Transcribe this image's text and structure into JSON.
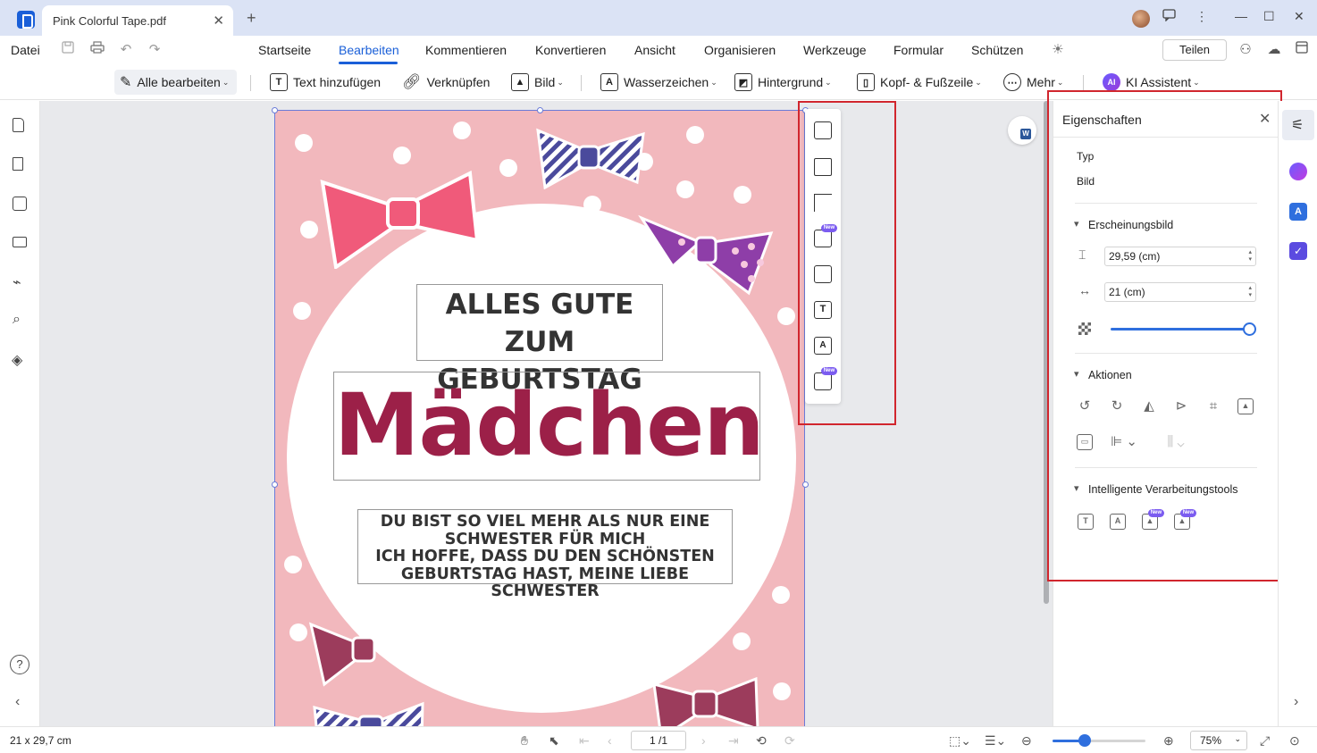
{
  "window": {
    "tab_title": "Pink Colorful Tape.pdf",
    "tab_close": "✕",
    "new_tab": "+",
    "min": "—",
    "max": "☐",
    "close": "✕"
  },
  "menubar": {
    "file": "Datei",
    "tabs": [
      "Startseite",
      "Bearbeiten",
      "Kommentieren",
      "Konvertieren",
      "Ansicht",
      "Organisieren",
      "Werkzeuge",
      "Formular",
      "Schützen"
    ],
    "active_tab": "Bearbeiten",
    "share": "Teilen"
  },
  "toolbar": {
    "edit_all": "Alle bearbeiten",
    "add_text": "Text hinzufügen",
    "link": "Verknüpfen",
    "image": "Bild",
    "watermark": "Wasserzeichen",
    "background": "Hintergrund",
    "header_footer": "Kopf- & Fußzeile",
    "more": "Mehr",
    "ai_badge": "AI",
    "ai_assistant": "KI Assistent"
  },
  "document": {
    "headline_line1": "ALLES GUTE ZUM",
    "headline_line2": "GEBURTSTAG",
    "name": "Mädchen",
    "message_line1": "DU BIST SO VIEL MEHR ALS NUR EINE",
    "message_line2": "SCHWESTER FÜR MICH",
    "message_line3": "ICH HOFFE, DASS DU DEN SCHÖNSTEN",
    "message_line4": "GEBURTSTAG HAST, MEINE LIEBE SCHWESTER",
    "colors": {
      "page_bg": "#f2b8bd",
      "name_color": "#9c2048"
    }
  },
  "float_toolbar": {
    "new_badge": "New",
    "icons": [
      "add-image-icon",
      "save-image-icon",
      "crop-icon",
      "ai-image-icon",
      "replace-image-icon",
      "ocr-text-icon",
      "translate-image-icon",
      "ai-enhance-icon"
    ]
  },
  "panel": {
    "title": "Eigenschaften",
    "close": "✕",
    "type_label": "Typ",
    "type_value": "Bild",
    "appearance": "Erscheinungsbild",
    "height_value": "29,59 (cm)",
    "width_value": "21 (cm)",
    "opacity": 1.0,
    "actions": "Aktionen",
    "smart_tools": "Intelligente Verarbeitungstools",
    "new_badge": "New"
  },
  "statusbar": {
    "page_size": "21 x 29,7 cm",
    "page_indicator": "1 /1",
    "zoom": "75%",
    "zoom_fraction": 0.35
  }
}
